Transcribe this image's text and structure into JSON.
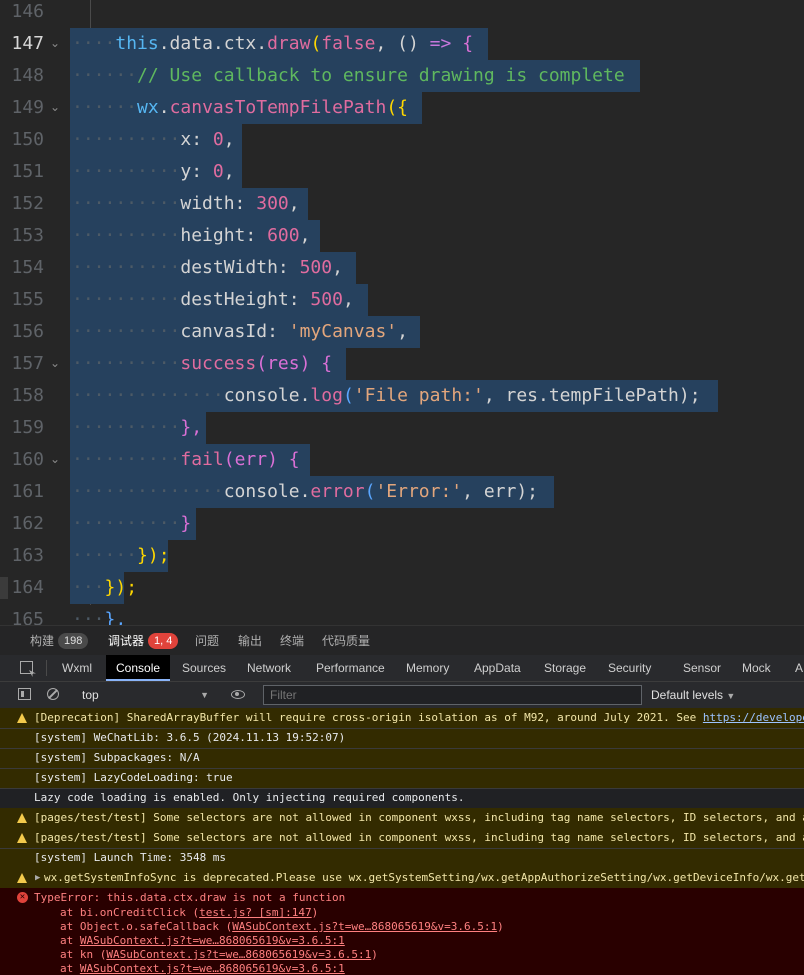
{
  "editor": {
    "lines": [
      {
        "n": "146",
        "active": false
      },
      {
        "n": "147",
        "active": true,
        "fold": true
      },
      {
        "n": "148",
        "active": false
      },
      {
        "n": "149",
        "active": false,
        "fold": true
      },
      {
        "n": "150",
        "active": false
      },
      {
        "n": "151",
        "active": false
      },
      {
        "n": "152",
        "active": false
      },
      {
        "n": "153",
        "active": false
      },
      {
        "n": "154",
        "active": false
      },
      {
        "n": "155",
        "active": false
      },
      {
        "n": "156",
        "active": false
      },
      {
        "n": "157",
        "active": false,
        "fold": true
      },
      {
        "n": "158",
        "active": false
      },
      {
        "n": "159",
        "active": false
      },
      {
        "n": "160",
        "active": false,
        "fold": true
      },
      {
        "n": "161",
        "active": false
      },
      {
        "n": "162",
        "active": false
      },
      {
        "n": "163",
        "active": false
      },
      {
        "n": "164",
        "active": false
      },
      {
        "n": "165",
        "active": false
      }
    ],
    "code": {
      "l147_this": "this",
      "l147_rest": ".data.ctx.",
      "l147_fn": "draw",
      "l147_p": "(",
      "l147_bool": "false",
      "l147_c": ", () ",
      "l147_arrow": "=>",
      "l147_b": " {",
      "l148": "// Use callback to ensure drawing is complete",
      "l149_wx": "wx",
      "l149_dot": ".",
      "l149_fn": "canvasToTempFilePath",
      "l149_p": "({",
      "l150_k": "x: ",
      "l150_v": "0",
      "l151_k": "y: ",
      "l151_v": "0",
      "l152_k": "width: ",
      "l152_v": "300",
      "l153_k": "height: ",
      "l153_v": "600",
      "l154_k": "destWidth: ",
      "l154_v": "500",
      "l155_k": "destHeight: ",
      "l155_v": "500",
      "l156_k": "canvasId: ",
      "l156_v": "'myCanvas'",
      "l157_fn": "success",
      "l157_p": "(res) {",
      "l158_a": "console.",
      "l158_fn": "log",
      "l158_s": "'File path:'",
      "l158_r": ", res.tempFilePath);",
      "l159": "},",
      "l160_fn": "fail",
      "l160_p": "(err) {",
      "l161_a": "console.",
      "l161_fn": "error",
      "l161_s": "'Error:'",
      "l161_r": ", err);",
      "l162": "}",
      "l163": "});",
      "l164": "});",
      "l165": "},"
    }
  },
  "panel_tabs": [
    {
      "label": "构建",
      "badge": "198"
    },
    {
      "label": "调试器",
      "badge": "1, 4"
    },
    {
      "label": "问题"
    },
    {
      "label": "输出"
    },
    {
      "label": "终端"
    },
    {
      "label": "代码质量"
    }
  ],
  "devtools_tabs": [
    "Wxml",
    "Console",
    "Sources",
    "Network",
    "Performance",
    "Memory",
    "AppData",
    "Storage",
    "Security",
    "Sensor",
    "Mock",
    "A"
  ],
  "toolbar": {
    "context": "top",
    "filter_placeholder": "Filter",
    "levels": "Default levels"
  },
  "console": {
    "m1": "[Deprecation] SharedArrayBuffer will require cross-origin isolation as of M92, around July 2021. See ",
    "m1_link": "https://develope",
    "m2": "[system] WeChatLib: 3.6.5 (2024.11.13 19:52:07)",
    "m3": "[system] Subpackages: N/A",
    "m4": "[system] LazyCodeLoading: true",
    "m5": "Lazy code loading is enabled. Only injecting required components.",
    "m6": "[pages/test/test] Some selectors are not allowed in component wxss, including tag name selectors, ID selectors, and a",
    "m7": "[pages/test/test] Some selectors are not allowed in component wxss, including tag name selectors, ID selectors, and a",
    "m8": "[system] Launch Time: 3548 ms",
    "m9": "wx.getSystemInfoSync is deprecated.Please use wx.getSystemSetting/wx.getAppAuthorizeSetting/wx.getDeviceInfo/wx.getW",
    "err": "TypeError: this.data.ctx.draw is not a function",
    "s1_pre": "at bi.onCreditClick (",
    "s1_link": "test.js? [sm]:147",
    "s1_post": ")",
    "s2_pre": "at Object.o.safeCallback (",
    "s2_link": "WASubContext.js?t=we…868065619&v=3.6.5:1",
    "s2_post": ")",
    "s3_pre": "at ",
    "s3_link": "WASubContext.js?t=we…868065619&v=3.6.5:1",
    "s4_pre": "at kn (",
    "s4_link": "WASubContext.js?t=we…868065619&v=3.6.5:1",
    "s4_post": ")",
    "s5_pre": "at ",
    "s5_link": "WASubContext.js?t=we…868065619&v=3.6.5:1"
  }
}
